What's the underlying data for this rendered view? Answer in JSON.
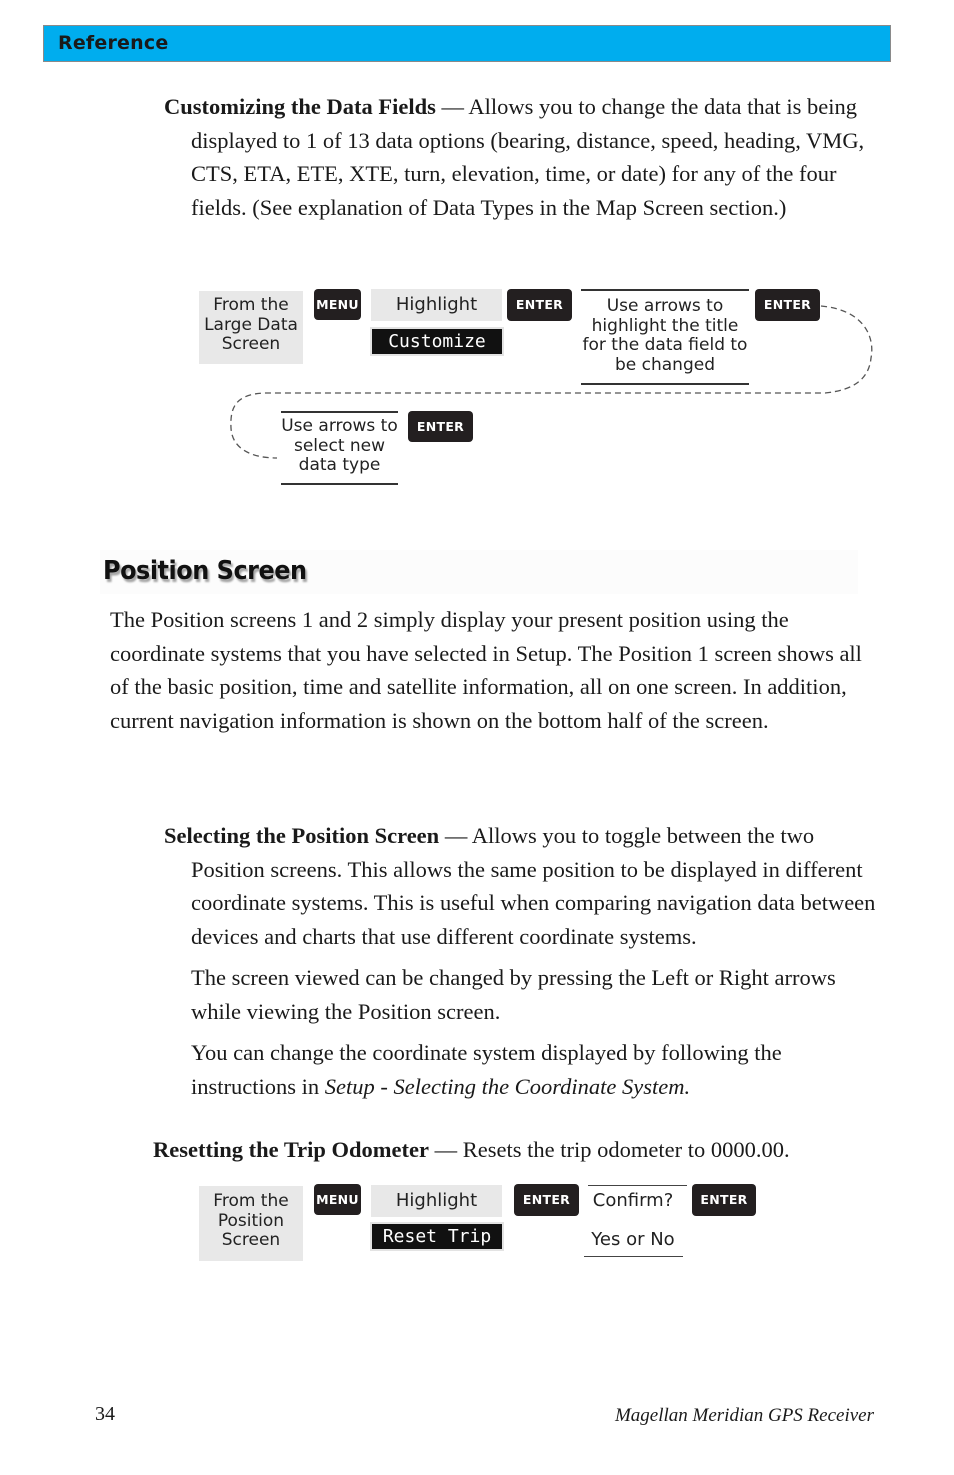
{
  "header": {
    "title": "Reference"
  },
  "customizing": {
    "term": "Customizing the Data Fields",
    "text": " — Allows you to change the data that is being displayed to 1 of 13 data options (bearing, distance, speed, heading, VMG, CTS, ETA, ETE, XTE, turn, elevation, time, or date) for any of the four fields. (See explanation of Data Types in the Map Screen section.)"
  },
  "flow1": {
    "start": [
      "From the",
      "Large Data",
      "Screen"
    ],
    "menu_key": "MENU",
    "highlight": "Highlight",
    "lcd_option": "Customize",
    "enter_key_1": "ENTER",
    "step_arrows": [
      "Use arrows to",
      "highlight the title",
      "for the data field to",
      "be changed"
    ],
    "enter_key_2": "ENTER",
    "step_select": [
      "Use arrows to",
      "select  new",
      "data type"
    ],
    "enter_key_3": "ENTER"
  },
  "position_section": {
    "title": "Position Screen",
    "intro": "The Position screens 1 and 2 simply display your present position using the coordinate systems that you have selected in Setup.  The Position 1 screen shows all of the basic position, time and satellite information, all on one screen.  In addition, current navigation information is shown on the bottom half of the screen."
  },
  "selecting": {
    "term": "Selecting the Position Screen",
    "text": "  — Allows you to toggle between the two Position screens.  This allows the same position to be displayed in different coordinate systems.  This is useful when comparing navigation data between devices and charts that use different coordinate systems.",
    "para2": "The screen viewed can be changed by pressing the Left or Right arrows while viewing the Position screen.",
    "para3_prefix": "You can change the coordinate system displayed by following the instructions in ",
    "para3_ref": "Setup - Selecting the Coordinate System."
  },
  "resetting": {
    "term": "Resetting the Trip Odometer",
    "text": " — Resets the trip odometer to 0000.00."
  },
  "flow2": {
    "start": [
      "From the",
      "Position",
      "Screen"
    ],
    "menu_key": "MENU",
    "highlight": "Highlight",
    "lcd_option": "Reset Trip",
    "enter_key_1": "ENTER",
    "confirm": "Confirm?",
    "choice": "Yes or No",
    "enter_key_2": "ENTER"
  },
  "footer": {
    "page_number": "34",
    "book_title": "Magellan Meridian GPS Receiver"
  }
}
